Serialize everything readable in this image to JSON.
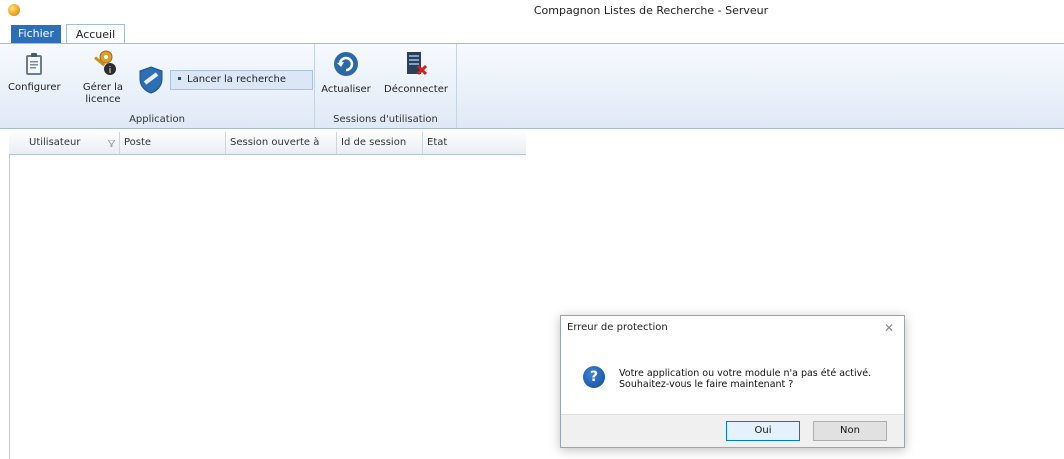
{
  "window": {
    "title": "Compagnon Listes de Recherche - Serveur"
  },
  "tabs": {
    "file": "Fichier",
    "home": "Accueil"
  },
  "ribbon": {
    "configure_label": "Configurer",
    "license_label_line1": "Gérer la",
    "license_label_line2": "licence",
    "search_label": "Lancer la recherche",
    "application_group": "Application",
    "refresh_label": "Actualiser",
    "disconnect_label": "Déconnecter",
    "sessions_group": "Sessions d'utilisation"
  },
  "grid": {
    "columns": [
      "Utilisateur",
      "Poste",
      "Session ouverte à",
      "Id de session",
      "Etat"
    ]
  },
  "dialog": {
    "title": "Erreur de protection",
    "close_glyph": "✕",
    "message_line1": "Votre application ou votre module n'a pas été activé.",
    "message_line2": "Souhaitez-vous le faire maintenant ?",
    "icon_glyph": "?",
    "yes_label": "Oui",
    "no_label": "Non"
  },
  "icons": {
    "app": "app-icon",
    "configure": "clipboard-icon",
    "license": "keys-icon",
    "search": "shield-icon",
    "refresh": "refresh-icon",
    "disconnect": "server-disconnect-icon",
    "question": "question-icon",
    "filter": "filter-icon"
  },
  "colors": {
    "file_tab": "#2c6fb8",
    "accent": "#0078d7"
  }
}
